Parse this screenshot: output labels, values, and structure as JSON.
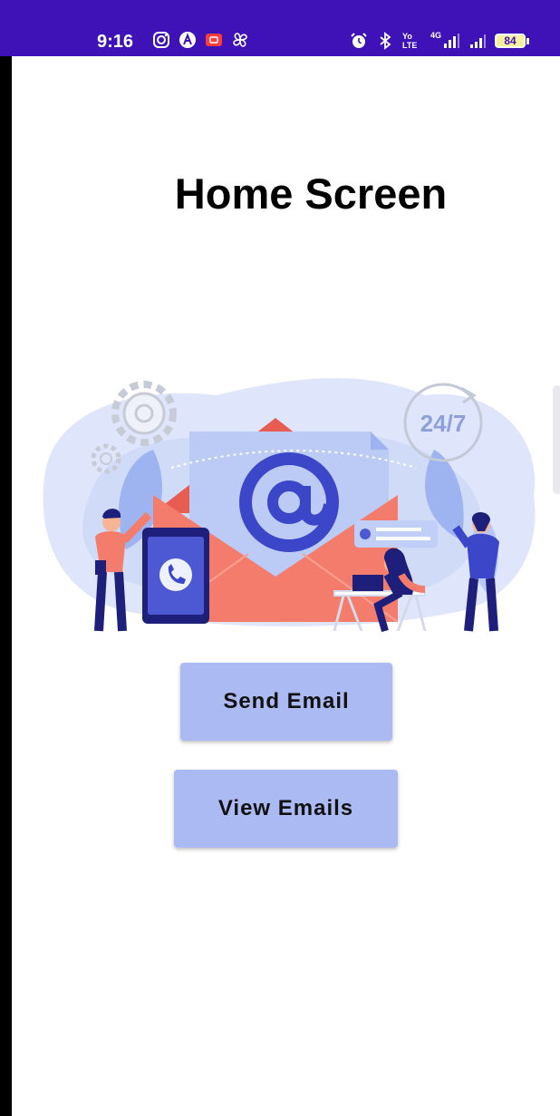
{
  "status_bar": {
    "time": "9:16",
    "network_label": "4G",
    "lte_label": "Yo LTE",
    "battery": "84"
  },
  "header": {
    "title": "Home Screen"
  },
  "illustration": {
    "clock_label": "24/7",
    "icons": [
      "email-at-icon",
      "phone-icon",
      "gear-icon",
      "chat-bubble-icon"
    ]
  },
  "buttons": {
    "send_email": "Send Email",
    "view_emails": "View Emails"
  },
  "colors": {
    "status_bar": "#3f12b7",
    "button": "#abbaf3",
    "envelope": "#f47c6c",
    "accent_blue": "#3b47c8"
  }
}
